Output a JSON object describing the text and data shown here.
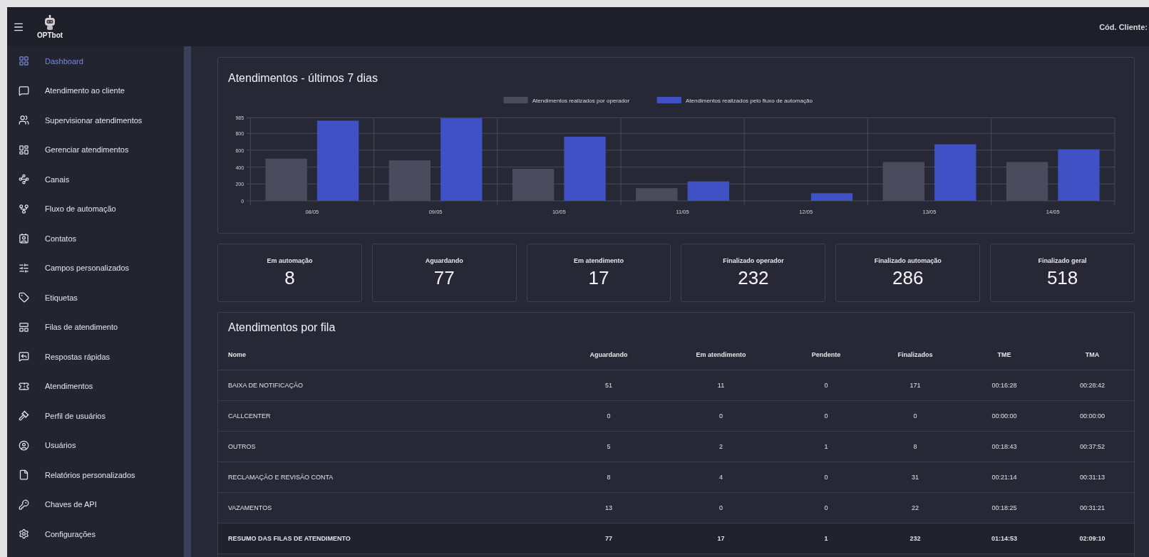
{
  "header": {
    "logo_text": "OPTbot",
    "client_code": "Cód. Cliente:"
  },
  "sidebar": {
    "items": [
      {
        "label": "Dashboard",
        "selected": true
      },
      {
        "label": "Atendimento ao cliente",
        "selected": false
      },
      {
        "label": "Supervisionar atendimentos",
        "selected": false
      },
      {
        "label": "Gerenciar atendimentos",
        "selected": false
      },
      {
        "label": "Canais",
        "selected": false
      },
      {
        "label": "Fluxo de automação",
        "selected": false
      },
      {
        "label": "Contatos",
        "selected": false
      },
      {
        "label": "Campos personalizados",
        "selected": false
      },
      {
        "label": "Etiquetas",
        "selected": false
      },
      {
        "label": "Filas de atendimento",
        "selected": false
      },
      {
        "label": "Respostas rápidas",
        "selected": false
      },
      {
        "label": "Atendimentos",
        "selected": false
      },
      {
        "label": "Perfil de usuários",
        "selected": false
      },
      {
        "label": "Usuários",
        "selected": false
      },
      {
        "label": "Relatórios personalizados",
        "selected": false
      },
      {
        "label": "Chaves de API",
        "selected": false
      },
      {
        "label": "Configurações",
        "selected": false
      }
    ]
  },
  "chart_card": {
    "title": "Atendimentos - últimos 7 dias",
    "chart_data": {
      "type": "bar",
      "categories": [
        "08/05",
        "09/05",
        "10/05",
        "11/05",
        "12/05",
        "13/05",
        "14/05"
      ],
      "series": [
        {
          "name": "Atendimentos realizados por operador",
          "color": "#4a4b5c",
          "values": [
            500,
            480,
            380,
            150,
            0,
            460,
            460
          ]
        },
        {
          "name": "Atendimentos realizados pelo fluxo de automação",
          "color": "#3f51c4",
          "values": [
            950,
            980,
            760,
            230,
            90,
            670,
            610
          ]
        }
      ],
      "ylim": [
        0,
        985
      ],
      "yticks": [
        0,
        200,
        400,
        600,
        800,
        985
      ],
      "grid": true,
      "legend": true
    }
  },
  "stats": [
    {
      "label": "Em automação",
      "value": "8"
    },
    {
      "label": "Aguardando",
      "value": "77"
    },
    {
      "label": "Em atendimento",
      "value": "17"
    },
    {
      "label": "Finalizado operador",
      "value": "232"
    },
    {
      "label": "Finalizado automação",
      "value": "286"
    },
    {
      "label": "Finalizado geral",
      "value": "518"
    }
  ],
  "queue_table": {
    "title": "Atendimentos por fila",
    "columns": [
      "Nome",
      "Aguardando",
      "Em atendimento",
      "Pendente",
      "Finalizados",
      "TME",
      "TMA"
    ],
    "rows": [
      {
        "kind": "queue",
        "cells": [
          "BAIXA DE NOTIFICAÇÃO",
          "51",
          "11",
          "0",
          "171",
          "00:16:28",
          "00:28:42"
        ]
      },
      {
        "kind": "queue",
        "cells": [
          "CALLCENTER",
          "0",
          "0",
          "0",
          "0",
          "00:00:00",
          "00:00:00"
        ]
      },
      {
        "kind": "queue",
        "cells": [
          "OUTROS",
          "5",
          "2",
          "1",
          "8",
          "00:18:43",
          "00:37:52"
        ]
      },
      {
        "kind": "queue",
        "cells": [
          "RECLAMAÇÃO E REVISÃO CONTA",
          "8",
          "4",
          "0",
          "31",
          "00:21:14",
          "00:31:13"
        ]
      },
      {
        "kind": "queue",
        "cells": [
          "VAZAMENTOS",
          "13",
          "0",
          "0",
          "22",
          "00:18:25",
          "00:31:21"
        ]
      },
      {
        "kind": "total",
        "cells": [
          "RESUMO DAS FILAS DE ATENDIMENTO",
          "77",
          "17",
          "1",
          "232",
          "01:14:53",
          "02:09:10"
        ]
      }
    ]
  }
}
